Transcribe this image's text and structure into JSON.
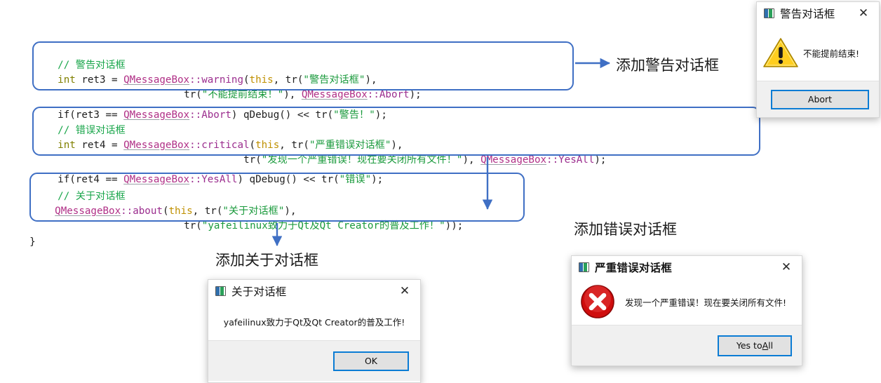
{
  "code": {
    "blocks": [
      {
        "id": "warning-block",
        "comment": "// 警告对话框",
        "line1_a": "int",
        "line1_b": " ret3 = ",
        "line1_c": "QMessageBox",
        "line1_d": "::warning",
        "line1_e": "(",
        "line1_f": "this",
        "line1_g": ", tr(",
        "line1_h": "\"警告对话框\"",
        "line1_i": "),",
        "line2_a": "tr(",
        "line2_b": "\"不能提前结束！\"",
        "line2_c": "), ",
        "line2_d": "QMessageBox",
        "line2_e": "::Abort",
        "line2_f": ");"
      }
    ],
    "if_line_1": {
      "a": "if(ret3 == ",
      "b": "QMessageBox",
      "c": "::Abort",
      "d": ") qDebug() << tr(",
      "e": "\"警告！\"",
      "f": ");"
    },
    "critical_block": {
      "comment": "// 错误对话框",
      "line1_a": "int",
      "line1_b": " ret4 = ",
      "line1_c": "QMessageBox",
      "line1_d": "::critical",
      "line1_e": "(",
      "line1_f": "this",
      "line1_g": ", tr(",
      "line1_h": "\"严重错误对话框\"",
      "line1_i": "),",
      "line2_a": "tr(",
      "line2_b": "\"发现一个严重错误！现在要关闭所有文件！\"",
      "line2_c": "), ",
      "line2_d": "QMessageBox",
      "line2_e": "::YesAll",
      "line2_f": ");"
    },
    "if_line_2": {
      "a": "if(ret4 == ",
      "b": "QMessageBox",
      "c": "::YesAll",
      "d": ") qDebug() << tr(",
      "e": "\"错误\"",
      "f": ");"
    },
    "about_block": {
      "comment": "// 关于对话框",
      "line1_a": "QMessageBox",
      "line1_b": "::about",
      "line1_c": "(",
      "line1_d": "this",
      "line1_e": ", tr(",
      "line1_f": "\"关于对话框\"",
      "line1_g": "),",
      "line2_a": "tr(",
      "line2_b": "\"yafeilinux致力于Qt及Qt Creator的普及工作！\"",
      "line2_c": "));"
    },
    "closing_brace": "}"
  },
  "annotations": {
    "warning_label": "添加警告对话框",
    "critical_label": "添加错误对话框",
    "about_label": "添加关于对话框",
    "arrow_color": "#3f6fc4"
  },
  "dialogs": {
    "warning": {
      "title": "警告对话框",
      "close_icon": "✕",
      "message": "不能提前结束!",
      "button": "Abort",
      "icon": "warning-triangle-icon",
      "icon_color": "#ffc700"
    },
    "critical": {
      "title": "严重错误对话框",
      "close_icon": "✕",
      "message": "发现一个严重错误！现在要关闭所有文件!",
      "button_pre": "Yes to ",
      "button_accel": "A",
      "button_post": "ll",
      "icon": "error-circle-icon",
      "icon_color": "#cc0000"
    },
    "about": {
      "title": "关于对话框",
      "close_icon": "✕",
      "message": "yafeilinux致力于Qt及Qt Creator的普及工作!",
      "button": "OK"
    }
  },
  "colors": {
    "box_outline": "#3f6fc4",
    "string": "#1a9a3c",
    "comment": "#1aa64b",
    "class": "#b02f86",
    "keyword": "#808000",
    "this": "#bf9000",
    "accent_button_border": "#0b7cd4"
  }
}
